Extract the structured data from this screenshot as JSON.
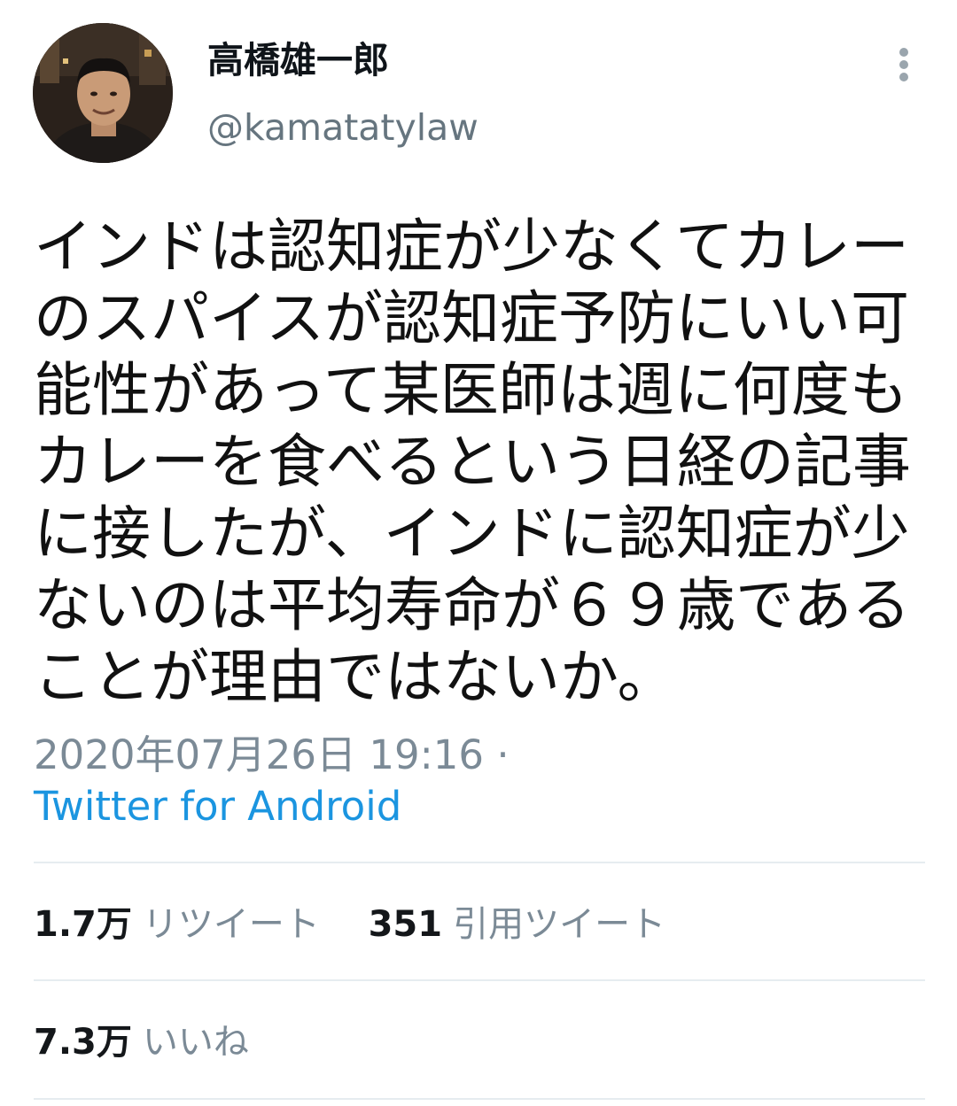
{
  "user": {
    "display_name": "高橋雄一郎",
    "handle": "@kamatatylaw",
    "avatar_icon": "user-avatar-photo"
  },
  "menu": {
    "icon": "more-vertical-icon"
  },
  "tweet": {
    "lines": [
      "インドは認知症が少なくてカレー",
      "のスパイスが認知症予防にいい可",
      "能性があって某医師は週に何度も",
      "カレーを食べるという日経の記事",
      "に接したが、インドに認知症が少",
      "ないのは平均寿命が６９歳である",
      "ことが理由ではないか。"
    ],
    "timestamp": "2020年07月26日 19:16 ·",
    "source": "Twitter for Android"
  },
  "stats": {
    "retweets": {
      "count": "1.7万",
      "label": "リツイート"
    },
    "quotes": {
      "count": "351",
      "label": "引用ツイート"
    },
    "likes": {
      "count": "7.3万",
      "label": "いいね"
    }
  },
  "colors": {
    "text": "#111111",
    "secondary": "#7b8a96",
    "link": "#1b95e0",
    "divider": "#e6ecf0"
  }
}
